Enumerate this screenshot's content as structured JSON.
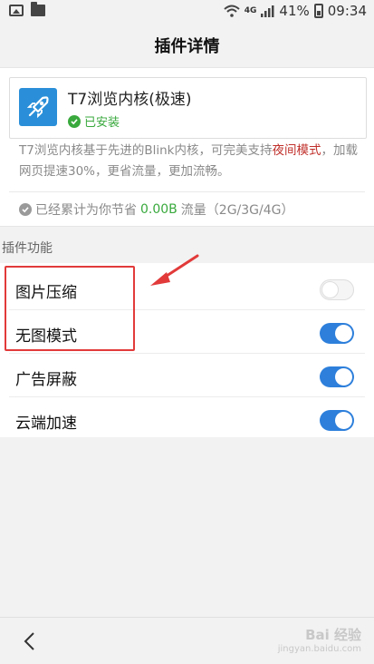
{
  "status_bar": {
    "left_icons": [
      "image-icon",
      "folder-icon"
    ],
    "network_label": "4G",
    "battery": "41%",
    "time": "09:34"
  },
  "header": {
    "title": "插件详情"
  },
  "plugin": {
    "name": "T7浏览内核(极速)",
    "status": "已安装",
    "desc_part1": "T7浏览内核基于先进的Blink内核，可完美支持",
    "desc_highlight": "夜间模式",
    "desc_part2": "，加载网页提速30%，更省流量，更加流畅。",
    "savings_prefix": "已经累计为你节省",
    "savings_amount": "0.00B",
    "savings_suffix": "流量（2G/3G/4G）"
  },
  "features": {
    "section_label": "插件功能",
    "items": [
      {
        "label": "图片压缩",
        "enabled": false
      },
      {
        "label": "无图模式",
        "enabled": true
      },
      {
        "label": "广告屏蔽",
        "enabled": true
      },
      {
        "label": "云端加速",
        "enabled": true
      }
    ]
  },
  "watermark": {
    "main": "Bai 经验",
    "sub": "jingyan.baidu.com"
  },
  "colors": {
    "accent_blue": "#2d7fdb",
    "installed_green": "#39a93d",
    "highlight_red": "#c0302b",
    "annotation_red": "#e23a3a"
  }
}
